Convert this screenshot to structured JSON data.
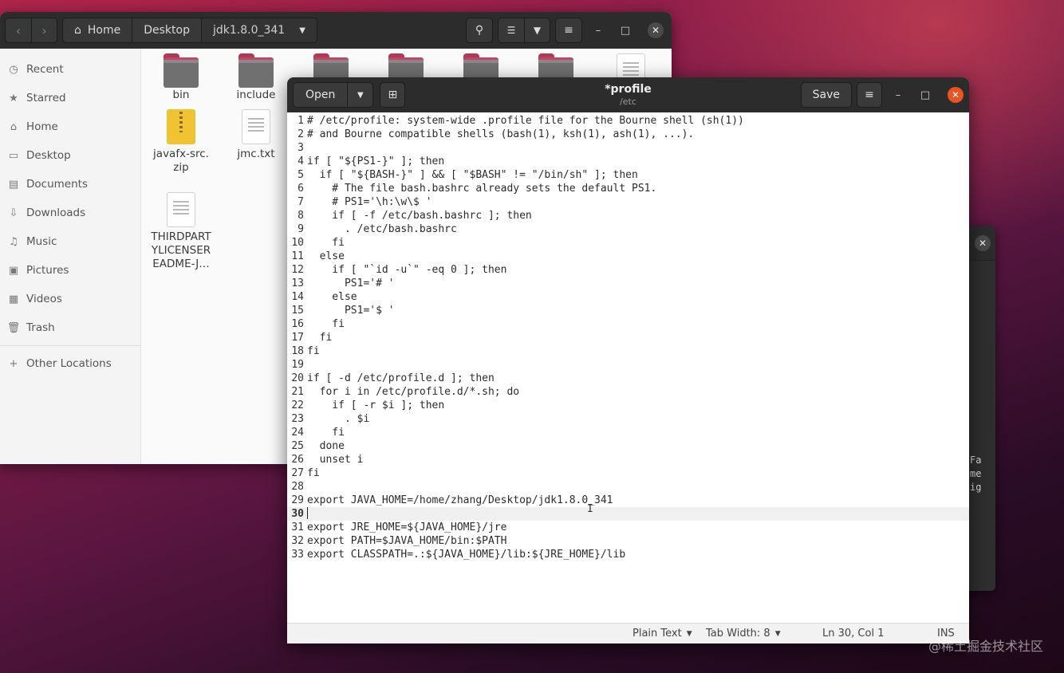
{
  "files": {
    "nav": {
      "back": "‹",
      "forward": "›"
    },
    "breadcrumbs": [
      "Home",
      "Desktop",
      "jdk1.8.0_341"
    ],
    "sidebar": [
      {
        "label": "Recent",
        "icon": "clock-icon"
      },
      {
        "label": "Starred",
        "icon": "star-icon"
      },
      {
        "label": "Home",
        "icon": "home-icon"
      },
      {
        "label": "Desktop",
        "icon": "desktop-icon"
      },
      {
        "label": "Documents",
        "icon": "document-icon"
      },
      {
        "label": "Downloads",
        "icon": "download-icon"
      },
      {
        "label": "Music",
        "icon": "music-icon"
      },
      {
        "label": "Pictures",
        "icon": "picture-icon"
      },
      {
        "label": "Videos",
        "icon": "video-icon"
      },
      {
        "label": "Trash",
        "icon": "trash-icon"
      },
      {
        "label": "Other Locations",
        "icon": "plus-icon"
      }
    ],
    "items": [
      {
        "name": "bin",
        "type": "folder"
      },
      {
        "name": "include",
        "type": "folder"
      },
      {
        "name": "",
        "type": "folder"
      },
      {
        "name": "",
        "type": "folder"
      },
      {
        "name": "",
        "type": "folder"
      },
      {
        "name": "",
        "type": "folder"
      },
      {
        "name": "",
        "type": "document"
      },
      {
        "name": "javafx-src.\nzip",
        "type": "zip"
      },
      {
        "name": "jmc.txt",
        "type": "document"
      },
      {
        "name": "THIRDPART\nYLICENSER\nEADME-J…",
        "type": "document"
      }
    ]
  },
  "editor": {
    "open_label": "Open",
    "title": "*profile",
    "subtitle": "/etc",
    "save_label": "Save",
    "current_line": 30,
    "lines": [
      "# /etc/profile: system-wide .profile file for the Bourne shell (sh(1))",
      "# and Bourne compatible shells (bash(1), ksh(1), ash(1), ...).",
      "",
      "if [ \"${PS1-}\" ]; then",
      "  if [ \"${BASH-}\" ] && [ \"$BASH\" != \"/bin/sh\" ]; then",
      "    # The file bash.bashrc already sets the default PS1.",
      "    # PS1='\\h:\\w\\$ '",
      "    if [ -f /etc/bash.bashrc ]; then",
      "      . /etc/bash.bashrc",
      "    fi",
      "  else",
      "    if [ \"`id -u`\" -eq 0 ]; then",
      "      PS1='# '",
      "    else",
      "      PS1='$ '",
      "    fi",
      "  fi",
      "fi",
      "",
      "if [ -d /etc/profile.d ]; then",
      "  for i in /etc/profile.d/*.sh; do",
      "    if [ -r $i ]; then",
      "      . $i",
      "    fi",
      "  done",
      "  unset i",
      "fi",
      "",
      "export JAVA_HOME=/home/zhang/Desktop/jdk1.8.0_341",
      "",
      "export JRE_HOME=${JAVA_HOME}/jre",
      "export PATH=$JAVA_HOME/bin:$PATH",
      "export CLASSPATH=.:${JAVA_HOME}/lib:${JRE_HOME}/lib"
    ],
    "status": {
      "language": "Plain Text",
      "tab_width": "Tab Width: 8",
      "position": "Ln 30, Col 1",
      "mode": "INS"
    }
  },
  "background_window": {
    "text_lines": [
      "Fa",
      "me",
      "ig"
    ]
  },
  "watermark": "@稀土掘金技术社区",
  "colors": {
    "accent_close": "#e95420",
    "folder_tab": "#c64466"
  }
}
